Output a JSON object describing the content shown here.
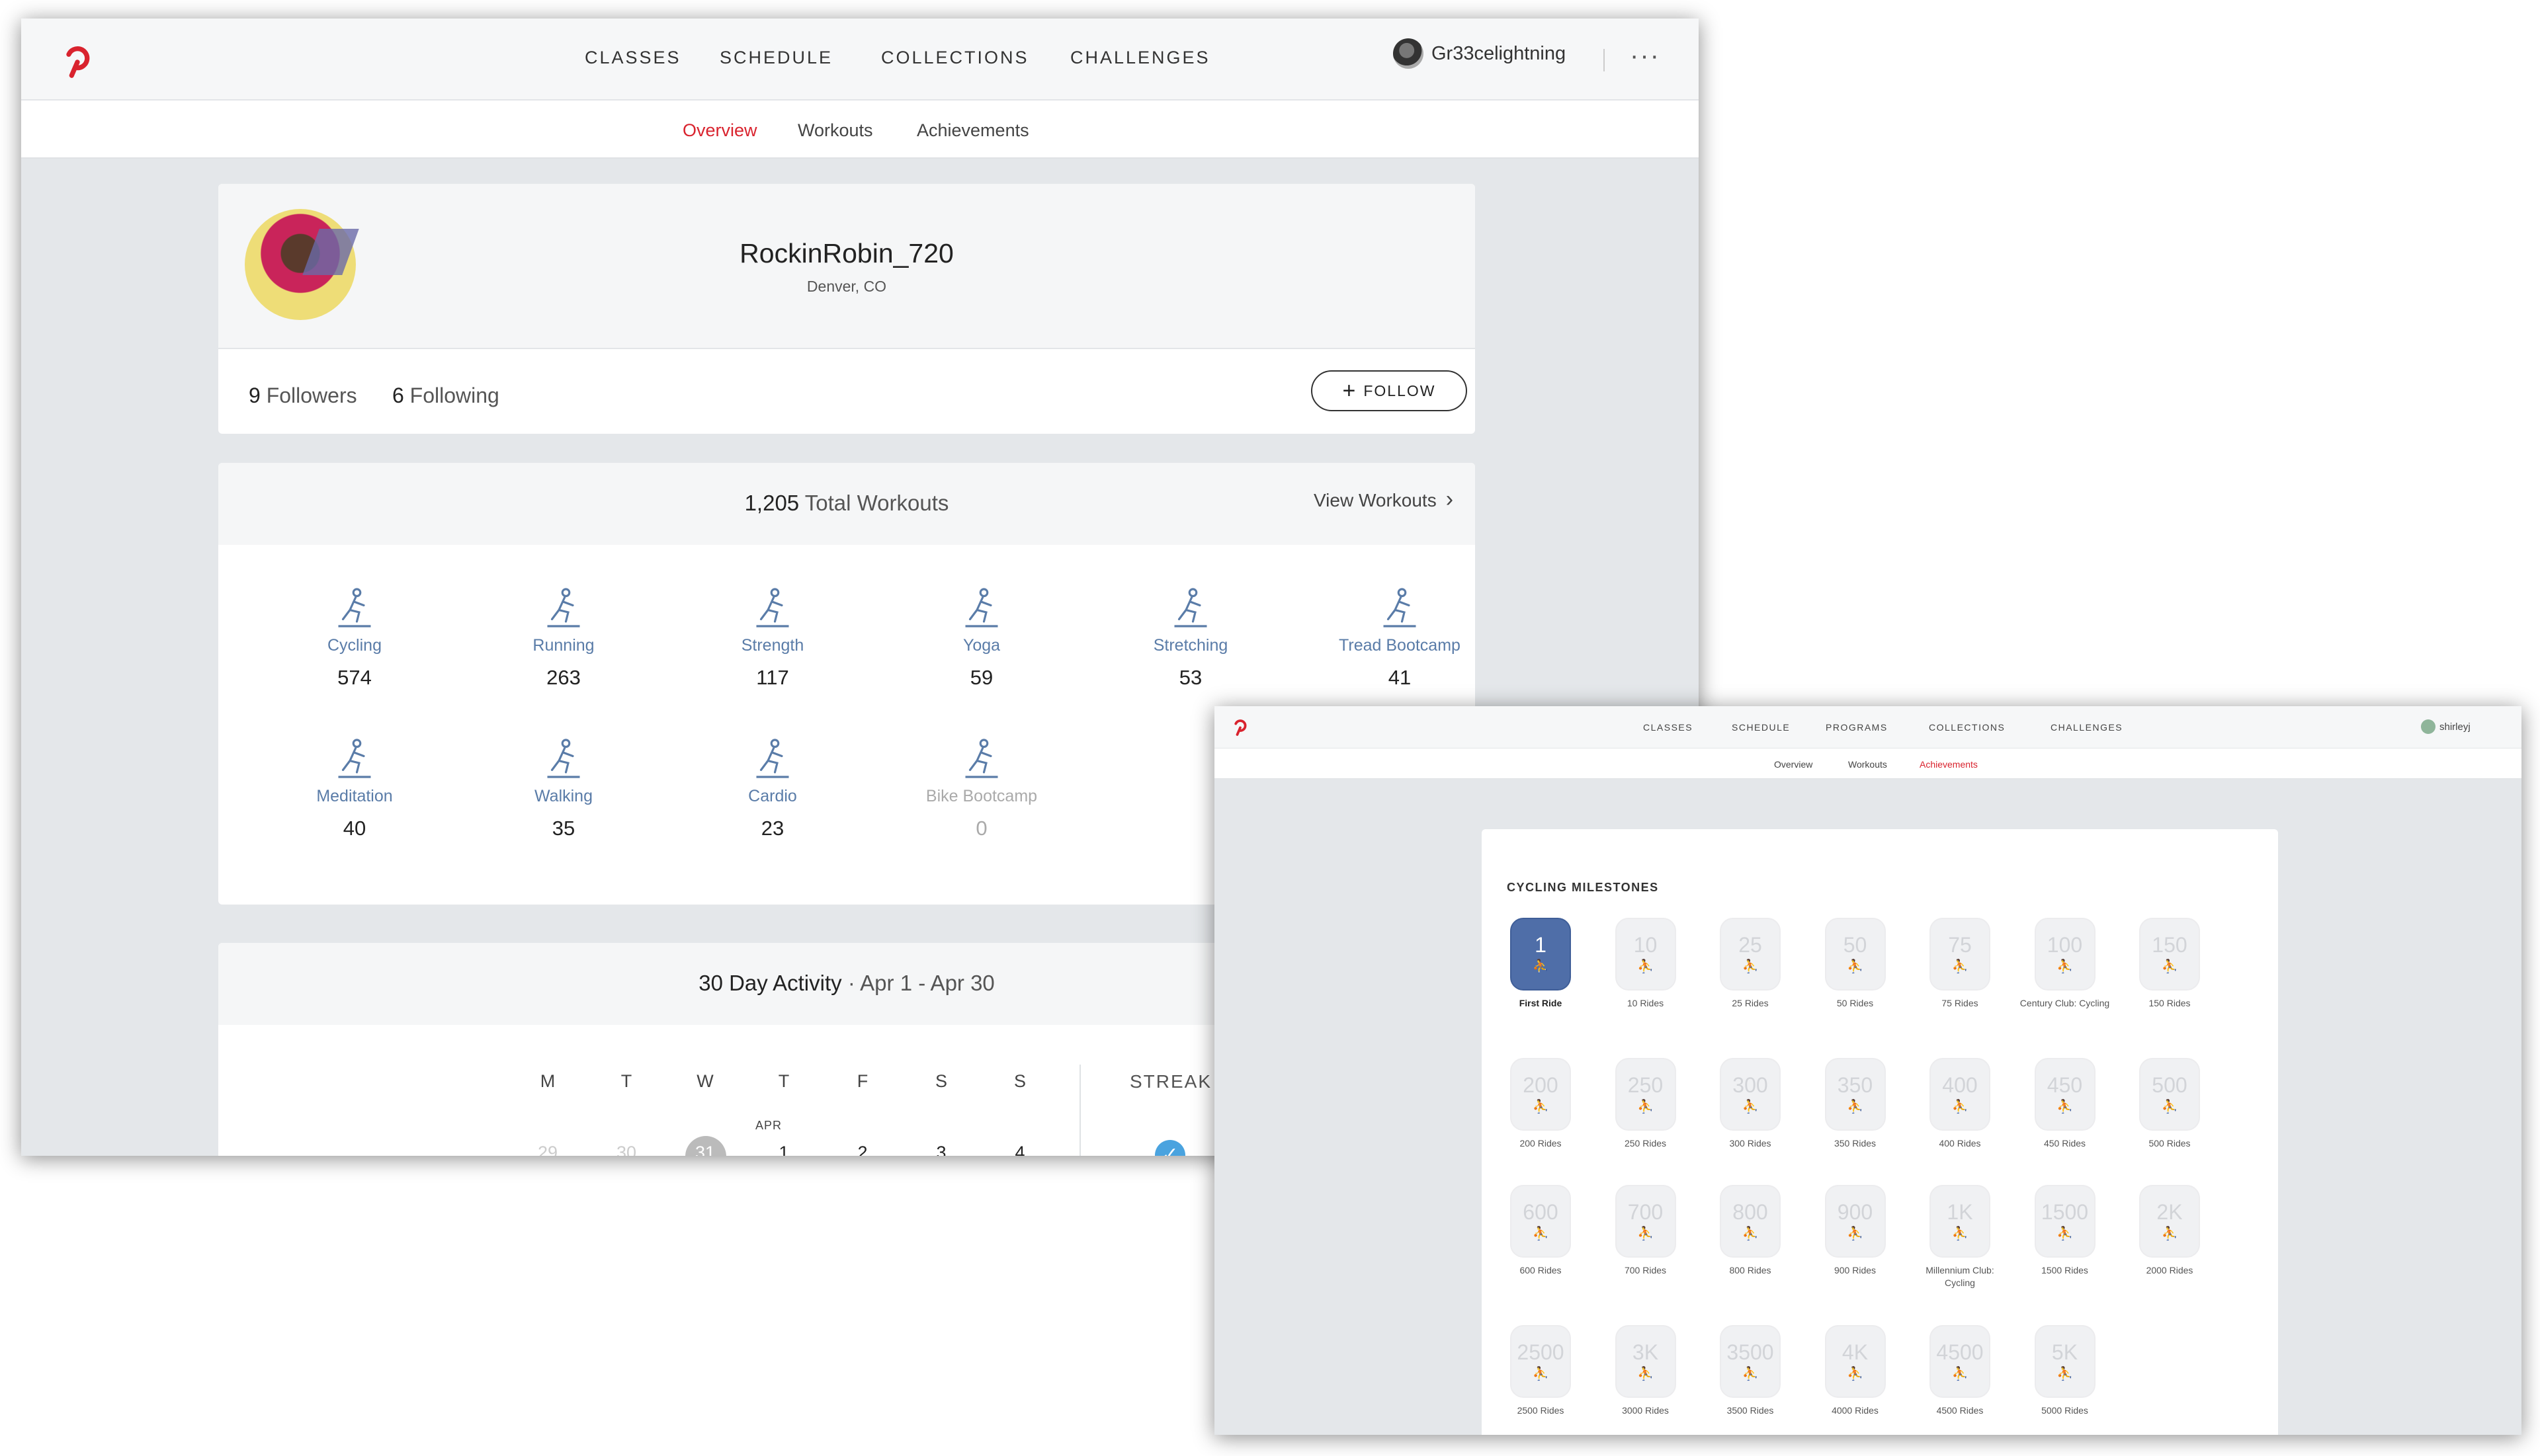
{
  "profile_window": {
    "nav": [
      "CLASSES",
      "SCHEDULE",
      "COLLECTIONS",
      "CHALLENGES"
    ],
    "username": "Gr33celightning",
    "more_menu": "···",
    "subnav": [
      "Overview",
      "Workouts",
      "Achievements"
    ],
    "active_subnav": "Overview",
    "profile": {
      "name": "RockinRobin_720",
      "location": "Denver, CO",
      "followers_count": "9",
      "followers_label": "Followers",
      "following_count": "6",
      "following_label": "Following",
      "follow_button": "FOLLOW"
    },
    "workouts": {
      "total_count": "1,205",
      "total_label": "Total Workouts",
      "view_link": "View Workouts",
      "disciplines": [
        {
          "name": "Cycling",
          "count": "574",
          "icon": "cycling-icon"
        },
        {
          "name": "Running",
          "count": "263",
          "icon": "running-icon"
        },
        {
          "name": "Strength",
          "count": "117",
          "icon": "strength-icon"
        },
        {
          "name": "Yoga",
          "count": "59",
          "icon": "yoga-icon"
        },
        {
          "name": "Stretching",
          "count": "53",
          "icon": "stretching-icon"
        },
        {
          "name": "Tread Bootcamp",
          "count": "41",
          "icon": "tread-bootcamp-icon"
        },
        {
          "name": "Meditation",
          "count": "40",
          "icon": "meditation-icon"
        },
        {
          "name": "Walking",
          "count": "35",
          "icon": "walking-icon"
        },
        {
          "name": "Cardio",
          "count": "23",
          "icon": "cardio-icon"
        },
        {
          "name": "Bike Bootcamp",
          "count": "0",
          "icon": "bike-bootcamp-icon"
        }
      ]
    },
    "activity": {
      "title": "30 Day Activity",
      "separator": "·",
      "range": "Apr 1 - Apr 30",
      "days": [
        "M",
        "T",
        "W",
        "T",
        "F",
        "S",
        "S"
      ],
      "month_label": "APR",
      "dates": [
        "29",
        "30",
        "31",
        "1",
        "2",
        "3",
        "4"
      ],
      "streak_label": "STREAK"
    }
  },
  "achievements_window": {
    "nav": [
      "CLASSES",
      "SCHEDULE",
      "PROGRAMS",
      "COLLECTIONS",
      "CHALLENGES"
    ],
    "username": "shirleyj",
    "subnav": [
      "Overview",
      "Workouts",
      "Achievements"
    ],
    "active_subnav": "Achievements",
    "section_title": "CYCLING MILESTONES",
    "milestones": [
      {
        "badge": "1",
        "label": "First Ride",
        "earned": true
      },
      {
        "badge": "10",
        "label": "10 Rides"
      },
      {
        "badge": "25",
        "label": "25 Rides"
      },
      {
        "badge": "50",
        "label": "50 Rides"
      },
      {
        "badge": "75",
        "label": "75 Rides"
      },
      {
        "badge": "100",
        "label": "Century Club: Cycling"
      },
      {
        "badge": "150",
        "label": "150 Rides"
      },
      {
        "badge": "200",
        "label": "200 Rides"
      },
      {
        "badge": "250",
        "label": "250 Rides"
      },
      {
        "badge": "300",
        "label": "300 Rides"
      },
      {
        "badge": "350",
        "label": "350 Rides"
      },
      {
        "badge": "400",
        "label": "400 Rides"
      },
      {
        "badge": "450",
        "label": "450 Rides"
      },
      {
        "badge": "500",
        "label": "500 Rides"
      },
      {
        "badge": "600",
        "label": "600 Rides"
      },
      {
        "badge": "700",
        "label": "700 Rides"
      },
      {
        "badge": "800",
        "label": "800 Rides"
      },
      {
        "badge": "900",
        "label": "900 Rides"
      },
      {
        "badge": "1K",
        "label": "Millennium Club: Cycling"
      },
      {
        "badge": "1500",
        "label": "1500 Rides"
      },
      {
        "badge": "2K",
        "label": "2000 Rides"
      },
      {
        "badge": "2500",
        "label": "2500 Rides"
      },
      {
        "badge": "3K",
        "label": "3000 Rides"
      },
      {
        "badge": "3500",
        "label": "3500 Rides"
      },
      {
        "badge": "4K",
        "label": "4000 Rides"
      },
      {
        "badge": "4500",
        "label": "4500 Rides"
      },
      {
        "badge": "5K",
        "label": "5000 Rides"
      }
    ]
  },
  "colors": {
    "brand_red": "#d9232e",
    "icon_blue": "#5a7ca8",
    "earned_badge": "#4f6ea8",
    "streak_check": "#4aa3df"
  }
}
